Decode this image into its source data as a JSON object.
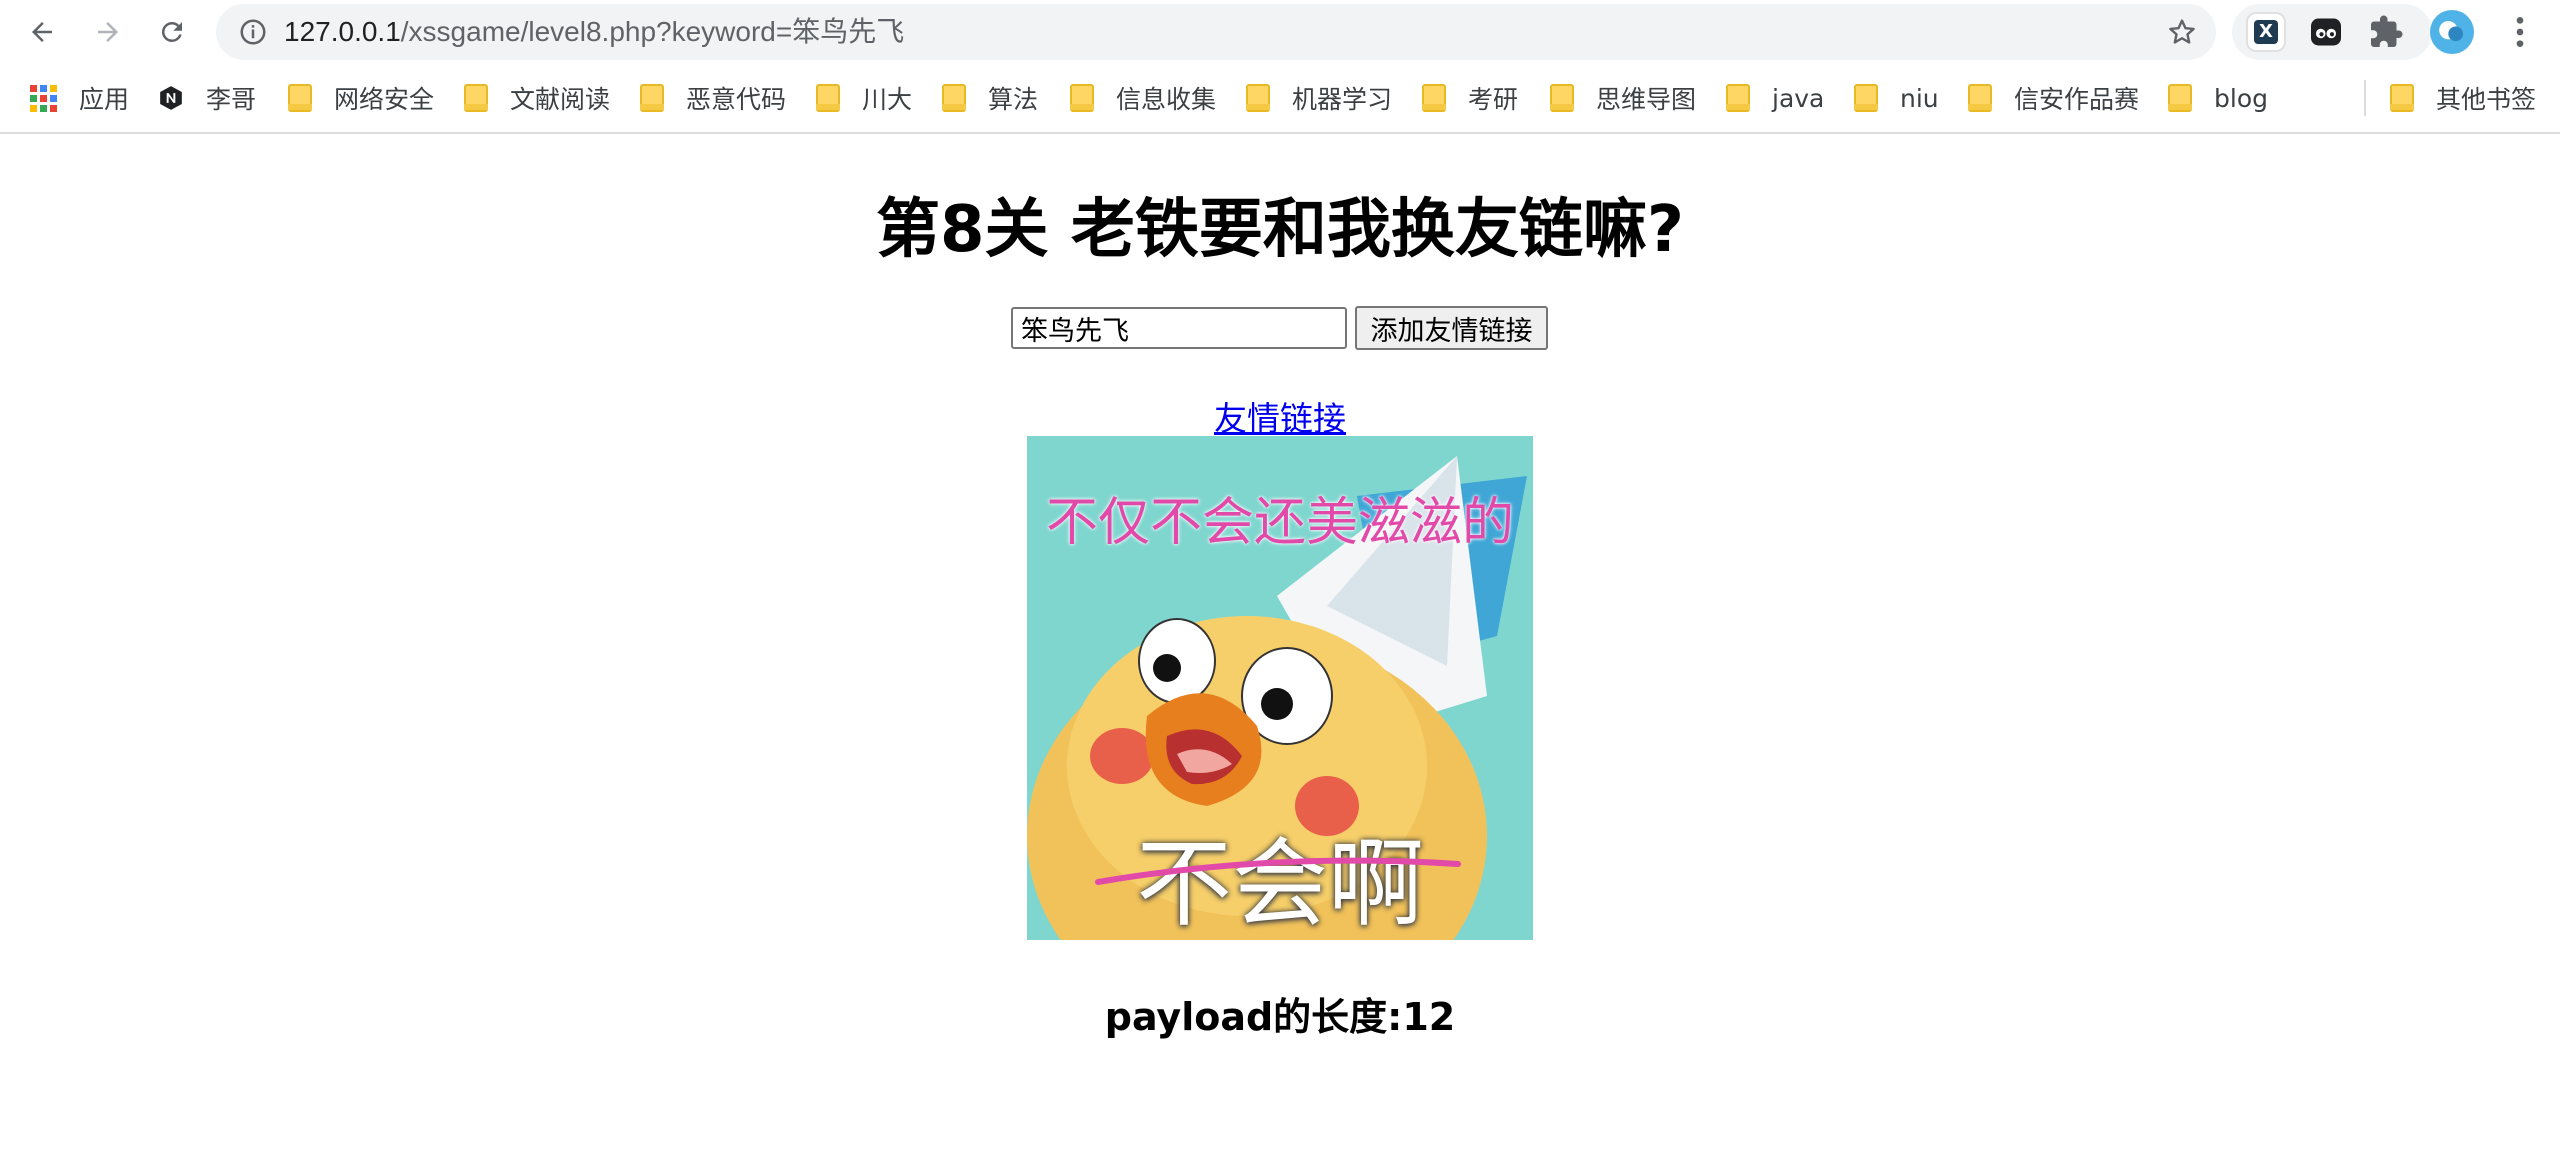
{
  "browser": {
    "url_host": "127.0.0.1",
    "url_path": "/xssgame/level8.php?keyword=笨鸟先飞",
    "profile_color": "#4fb3e8"
  },
  "bookmarks": {
    "apps": "应用",
    "items": [
      "李哥",
      "网络安全",
      "文献阅读",
      "恶意代码",
      "川大",
      "算法",
      "信息收集",
      "机器学习",
      "考研",
      "思维导图",
      "java",
      "niu",
      "信安作品赛",
      "blog"
    ],
    "other": "其他书签"
  },
  "page": {
    "title": "第8关 老铁要和我换友链嘛?",
    "input_value": "笨鸟先飞",
    "button_label": "添加友情链接",
    "link_text": "友情链接",
    "meme_top_text": "不仅不会还美滋滋的",
    "meme_bottom_text": "不会啊",
    "payload_length": "payload的长度:12"
  }
}
